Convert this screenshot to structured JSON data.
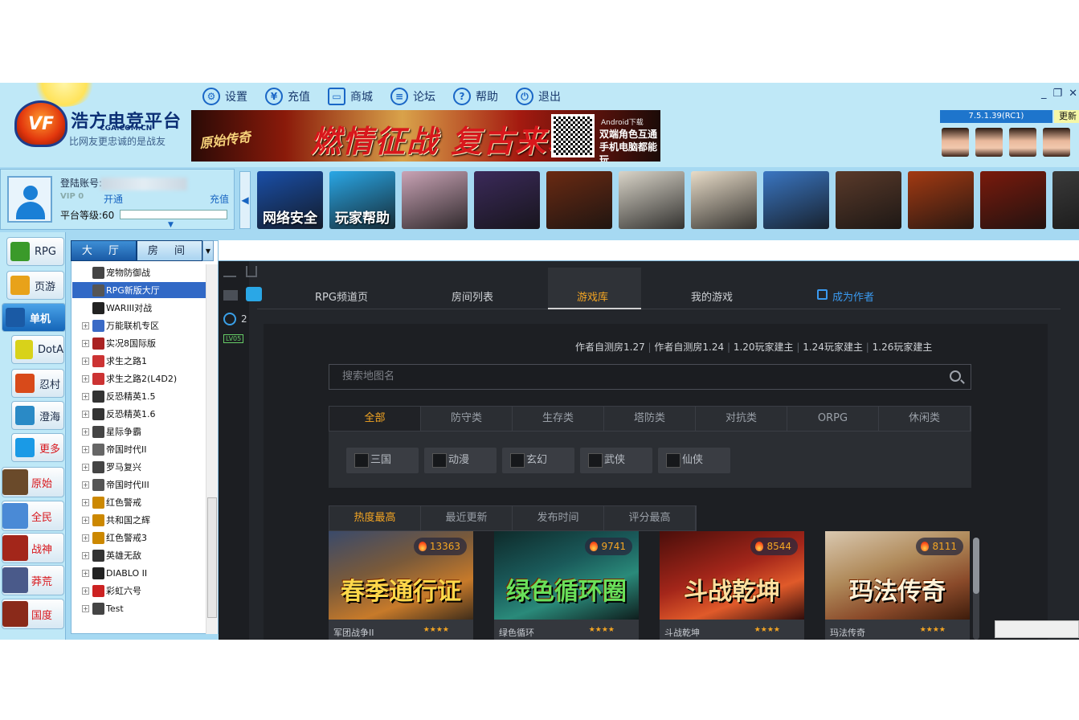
{
  "menu": [
    {
      "label": "设置",
      "icon": "gear-icon",
      "glyph": "⚙"
    },
    {
      "label": "充值",
      "icon": "yen-icon",
      "glyph": "¥"
    },
    {
      "label": "商城",
      "icon": "shop-bag-icon",
      "glyph": "▭"
    },
    {
      "label": "论坛",
      "icon": "forum-icon",
      "glyph": "≡"
    },
    {
      "label": "帮助",
      "icon": "help-icon",
      "glyph": "?"
    },
    {
      "label": "退出",
      "icon": "power-icon",
      "glyph": "⏻"
    }
  ],
  "brand": {
    "logo_text": "浩方电竞平台",
    "logo_url": "CGA.COM.CN",
    "slogan": "比网友更忠诚的是战友"
  },
  "banner": {
    "left": "原始传奇",
    "main": "燃情征战 复古来袭",
    "android": "Android下载",
    "line1": "双端角色互通",
    "line2": "手机电脑都能玩"
  },
  "window": {
    "min": "_",
    "restore": "❐",
    "close": "✕"
  },
  "version": "7.5.1.39(RC1)",
  "update_label": "更新",
  "user": {
    "account_label": "登陆账号:",
    "vip": "VIP 0",
    "open_label": "开通",
    "pay_label": "充值",
    "level_label": "平台等级:60",
    "expand": "▼"
  },
  "game_strip_arrow": "◀",
  "game_tiles": [
    {
      "label": "网络安全",
      "color": "#1a4fa8"
    },
    {
      "label": "玩家帮助",
      "color": "#2aa7e6"
    },
    {
      "label": "",
      "color": "#c9a3b5"
    },
    {
      "label": "",
      "color": "#3b2a5a"
    },
    {
      "label": "",
      "color": "#6a2a12"
    },
    {
      "label": "",
      "color": "#d9d4c8"
    },
    {
      "label": "",
      "color": "#e8dcc8"
    },
    {
      "label": "",
      "color": "#3a76c2"
    },
    {
      "label": "",
      "color": "#5a3a2a"
    },
    {
      "label": "",
      "color": "#a33a12"
    },
    {
      "label": "",
      "color": "#7a1a0c"
    },
    {
      "label": "",
      "color": "#3a3a3a"
    }
  ],
  "nav": [
    {
      "label": "RPG",
      "icon": "rpg-icon",
      "style": "plain"
    },
    {
      "label": "页游",
      "icon": "webgame-icon",
      "style": "plain"
    },
    {
      "label": "单机",
      "icon": "pc-icon",
      "style": "sel"
    },
    {
      "label": "DotA",
      "icon": "dota-icon",
      "style": "sub"
    },
    {
      "label": "忍村",
      "icon": "ninja-icon",
      "style": "sub"
    },
    {
      "label": "澄海",
      "icon": "chenghai-icon",
      "style": "sub"
    },
    {
      "label": "更多",
      "icon": "gamepad-icon",
      "style": "subred"
    },
    {
      "label": "原始",
      "icon": "yuanshi-icon",
      "style": "gm"
    },
    {
      "label": "全民",
      "icon": "quanmin-icon",
      "style": "gm"
    },
    {
      "label": "战神",
      "icon": "zhanshen-icon",
      "style": "gm"
    },
    {
      "label": "莽荒",
      "icon": "manghuang-icon",
      "style": "gm"
    },
    {
      "label": "国度",
      "icon": "guodu-icon",
      "style": "gm"
    }
  ],
  "tabs": {
    "hall": "大 厅",
    "room": "房 间",
    "dropdown": "▼"
  },
  "tree": [
    {
      "label": "宠物防御战",
      "child": true,
      "expand": ""
    },
    {
      "label": "RPG新版大厅",
      "child": true,
      "expand": "",
      "selected": true
    },
    {
      "label": "WARIII对战",
      "child": true,
      "expand": ""
    },
    {
      "label": "万能联机专区",
      "child": false,
      "expand": "+"
    },
    {
      "label": "实况8国际版",
      "child": false,
      "expand": "+"
    },
    {
      "label": "求生之路1",
      "child": false,
      "expand": "+"
    },
    {
      "label": "求生之路2(L4D2)",
      "child": false,
      "expand": "+"
    },
    {
      "label": "反恐精英1.5",
      "child": false,
      "expand": "+"
    },
    {
      "label": "反恐精英1.6",
      "child": false,
      "expand": "+"
    },
    {
      "label": "星际争霸",
      "child": false,
      "expand": "+"
    },
    {
      "label": "帝国时代II",
      "child": false,
      "expand": "+"
    },
    {
      "label": "罗马复兴",
      "child": false,
      "expand": "+"
    },
    {
      "label": "帝国时代III",
      "child": false,
      "expand": "+"
    },
    {
      "label": "红色警戒",
      "child": false,
      "expand": "+"
    },
    {
      "label": "共和国之辉",
      "child": false,
      "expand": "+"
    },
    {
      "label": "红色警戒3",
      "child": false,
      "expand": "+"
    },
    {
      "label": "英雄无敌",
      "child": false,
      "expand": "+"
    },
    {
      "label": "DIABLO II",
      "child": false,
      "expand": "+"
    },
    {
      "label": "彩虹六号",
      "child": false,
      "expand": "+"
    },
    {
      "label": "Test",
      "child": false,
      "expand": "+"
    }
  ],
  "side": {
    "users": "2",
    "level": "LV05"
  },
  "topnav": [
    {
      "label": "RPG频道页",
      "active": false
    },
    {
      "label": "房间列表",
      "active": false
    },
    {
      "label": "游戏库",
      "active": true
    },
    {
      "label": "我的游戏",
      "active": false
    },
    {
      "label": "成为作者",
      "active": false,
      "blue": true
    }
  ],
  "filters": [
    "作者自测房1.27",
    "作者自测房1.24",
    "1.20玩家建主",
    "1.24玩家建主",
    "1.26玩家建主"
  ],
  "search_placeholder": "搜索地图名",
  "categories": [
    "全部",
    "防守类",
    "生存类",
    "塔防类",
    "对抗类",
    "ORPG",
    "休闲类"
  ],
  "subcategories": [
    "三国",
    "动漫",
    "玄幻",
    "武侠",
    "仙侠"
  ],
  "sorts": [
    "热度最高",
    "最近更新",
    "发布时间",
    "评分最高"
  ],
  "cards": [
    {
      "title": "春季通行证",
      "heat": "13363",
      "caption": "军团战争II",
      "stars": "★★★★",
      "bg": "linear-gradient(160deg,#3a4a6a,#7a5a3a 40%,#c77a2a 70%,#3a2a1a)",
      "color": "#ffd84a"
    },
    {
      "title": "绿色循环圈",
      "heat": "9741",
      "caption": "绿色循环",
      "stars": "★★★★",
      "bg": "linear-gradient(160deg,#0e2a2a,#1a5a5a 40%,#2a8a7a 65%,#0e1a1a)",
      "color": "#6ae05a"
    },
    {
      "title": "斗战乾坤",
      "heat": "8544",
      "caption": "斗战乾坤",
      "stars": "★★★★",
      "bg": "linear-gradient(160deg,#4a0e0a,#a4261a 45%,#e05a2a 70%,#2a0a0a)",
      "color": "#ffe0a0"
    },
    {
      "title": "玛法传奇",
      "heat": "8111",
      "caption": "玛法传奇",
      "stars": "★★★★",
      "bg": "linear-gradient(160deg,#d9c8b0,#b08a5a 40%,#8a4a2a 70%,#3a1a0a)",
      "color": "#fff2d8"
    }
  ]
}
